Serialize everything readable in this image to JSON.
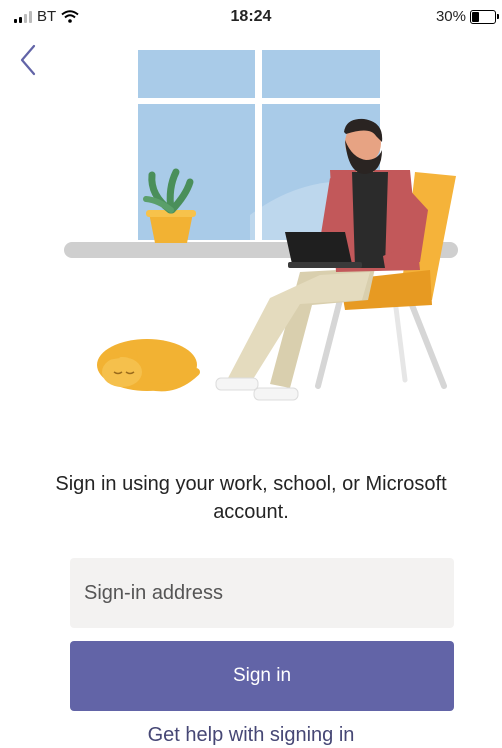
{
  "status_bar": {
    "carrier": "BT",
    "time": "18:24",
    "battery_percent": "30%",
    "battery_level": 0.3,
    "icons": [
      "signal-icon",
      "wifi-icon",
      "battery-icon"
    ]
  },
  "navigation": {
    "back_icon": "chevron-left-icon"
  },
  "illustration": {
    "description_icon": "person-working-on-laptop-illustration"
  },
  "main": {
    "prompt": "Sign in using your work, school, or Microsoft account.",
    "signin_placeholder": "Sign-in address",
    "signin_value": "",
    "signin_button": "Sign in",
    "help_link": "Get help with signing in"
  },
  "colors": {
    "accent": "#6264a7",
    "link": "#464775",
    "input_bg": "#f3f2f1"
  }
}
